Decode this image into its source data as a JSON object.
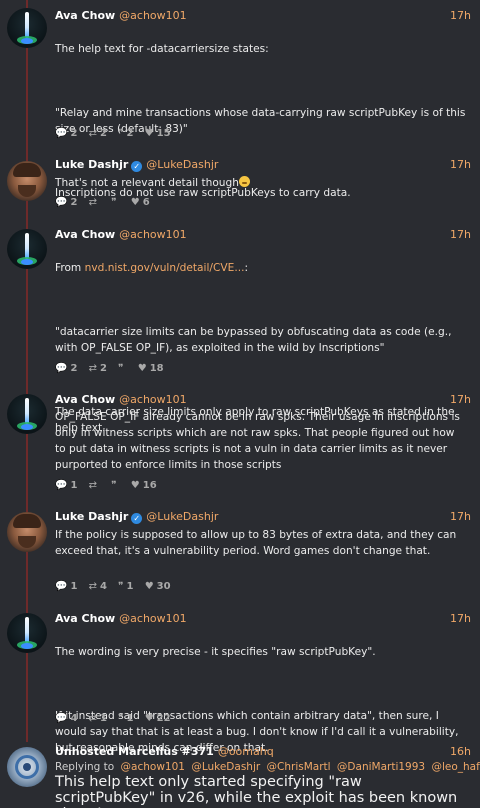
{
  "posts": [
    {
      "name": "Ava Chow",
      "handle": "@achow101",
      "time": "17h",
      "lines": [
        "The help text for -datacarriersize states:",
        "",
        "\"Relay and mine transactions whose data-carrying raw scriptPubKey is of this size or less (default: 83)\"",
        "",
        "Inscriptions do not use raw scriptPubKeys to carry data."
      ],
      "replies": "2",
      "reposts": "2",
      "quotes": "2",
      "likes": "15"
    },
    {
      "name": "Luke Dashjr",
      "handle": "@LukeDashjr",
      "time": "17h",
      "text": "That's not a relevant detail though",
      "replies": "2",
      "reposts": "",
      "quotes": "",
      "likes": "6"
    },
    {
      "name": "Ava Chow",
      "handle": "@achow101",
      "time": "17h",
      "from_prefix": "From ",
      "from_link": "nvd.nist.gov/vuln/detail/CVE...",
      "from_suffix": ":",
      "lines": [
        "\"datacarrier size limits can be bypassed by obfuscating data as code (e.g., with OP_FALSE OP_IF), as exploited in the wild by Inscriptions\"",
        "",
        "The data carrier size limits only apply to raw scriptPubKeys as stated in the help text."
      ],
      "replies": "2",
      "reposts": "2",
      "quotes": "",
      "likes": "18"
    },
    {
      "name": "Ava Chow",
      "handle": "@achow101",
      "time": "17h",
      "text": "OP_FALSE OP_IF already cannot be in raw spks. Their usage in inscriptions is only in witness scripts which are not raw spks. That people figured out how to put data in witness scripts is not a vuln in data carrier limits as it never purported to enforce limits in those scripts",
      "replies": "1",
      "reposts": "",
      "quotes": "",
      "likes": "16"
    },
    {
      "name": "Luke Dashjr",
      "handle": "@LukeDashjr",
      "time": "17h",
      "text": "If the policy is supposed to allow up to 83 bytes of extra data, and they can exceed that, it's a vulnerability period. Word games don't change that.",
      "replies": "1",
      "reposts": "4",
      "quotes": "1",
      "likes": "30"
    },
    {
      "name": "Ava Chow",
      "handle": "@achow101",
      "time": "17h",
      "lines": [
        "The wording is very precise - it specifies \"raw scriptPubKey\".",
        "",
        "If it instead said \"transactions which contain arbitrary data\", then sure, I would say that that is at least a bug. I don't know if I'd call it a vulnerability, but reasonable minds can differ on that."
      ],
      "replies": "4",
      "reposts": "1",
      "quotes": "1",
      "likes": "22"
    },
    {
      "name": "Unhosted Marcellus #371",
      "handle": "@oomahq",
      "time": "16h",
      "replying_prefix": "Replying to",
      "replying_to": [
        "@achow101",
        "@LukeDashjr",
        "@ChrisMartl",
        "@DaniMarti1993",
        "@leo_haf"
      ],
      "text": "This help text only started specifying \"raw scriptPubKey\" in v26, while the exploit has been known since January"
    }
  ],
  "icons": {
    "reply": "speech-bubble-icon",
    "repost": "repost-arrows-icon",
    "quote": "quote-icon",
    "like": "heart-icon",
    "verified": "verified-check-icon"
  },
  "colors": {
    "background": "#2a2c31",
    "accent": "#f0a868",
    "thread_line": "#6e2a2a",
    "verified": "#2f8ae0"
  }
}
